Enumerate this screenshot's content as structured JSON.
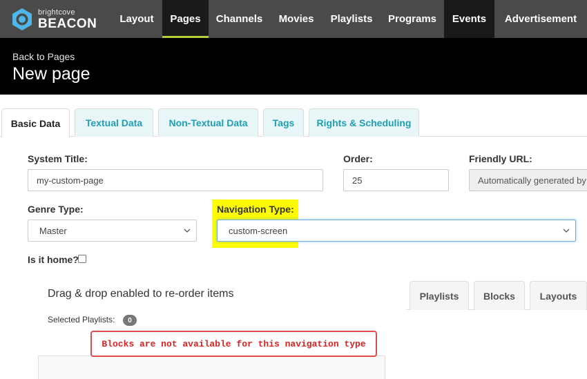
{
  "brand": {
    "small": "brightcove",
    "big": "BEACON"
  },
  "nav": {
    "items": [
      {
        "label": "Layout"
      },
      {
        "label": "Pages"
      },
      {
        "label": "Channels"
      },
      {
        "label": "Movies"
      },
      {
        "label": "Playlists"
      },
      {
        "label": "Programs"
      },
      {
        "label": "Events"
      },
      {
        "label": "Advertisement"
      }
    ],
    "active": "Pages"
  },
  "header": {
    "back": "Back to Pages",
    "title": "New page"
  },
  "tabs": [
    {
      "label": "Basic Data",
      "active": true
    },
    {
      "label": "Textual Data"
    },
    {
      "label": "Non-Textual Data"
    },
    {
      "label": "Tags"
    },
    {
      "label": "Rights & Scheduling"
    }
  ],
  "form": {
    "system_title": {
      "label": "System Title:",
      "value": "my-custom-page"
    },
    "order": {
      "label": "Order:",
      "value": "25"
    },
    "friendly_url": {
      "label": "Friendly URL:",
      "value": "Automatically generated by"
    },
    "genre_type": {
      "label": "Genre Type:",
      "value": "Master"
    },
    "navigation_type": {
      "label": "Navigation Type:",
      "value": "custom-screen"
    },
    "is_home": {
      "label": "Is it home?",
      "checked": false
    }
  },
  "items": {
    "drag_text": "Drag & drop enabled to re-order items",
    "selected_label": "Selected Playlists:",
    "selected_count": "0",
    "error": "Blocks are not available for this navigation type",
    "tabs": [
      {
        "label": "Playlists"
      },
      {
        "label": "Blocks"
      },
      {
        "label": "Layouts"
      }
    ]
  },
  "colors": {
    "accent": "#b6cf3a",
    "tab_text": "#1f9fb4",
    "error": "#e01f1f",
    "highlight": "#fffb00"
  }
}
